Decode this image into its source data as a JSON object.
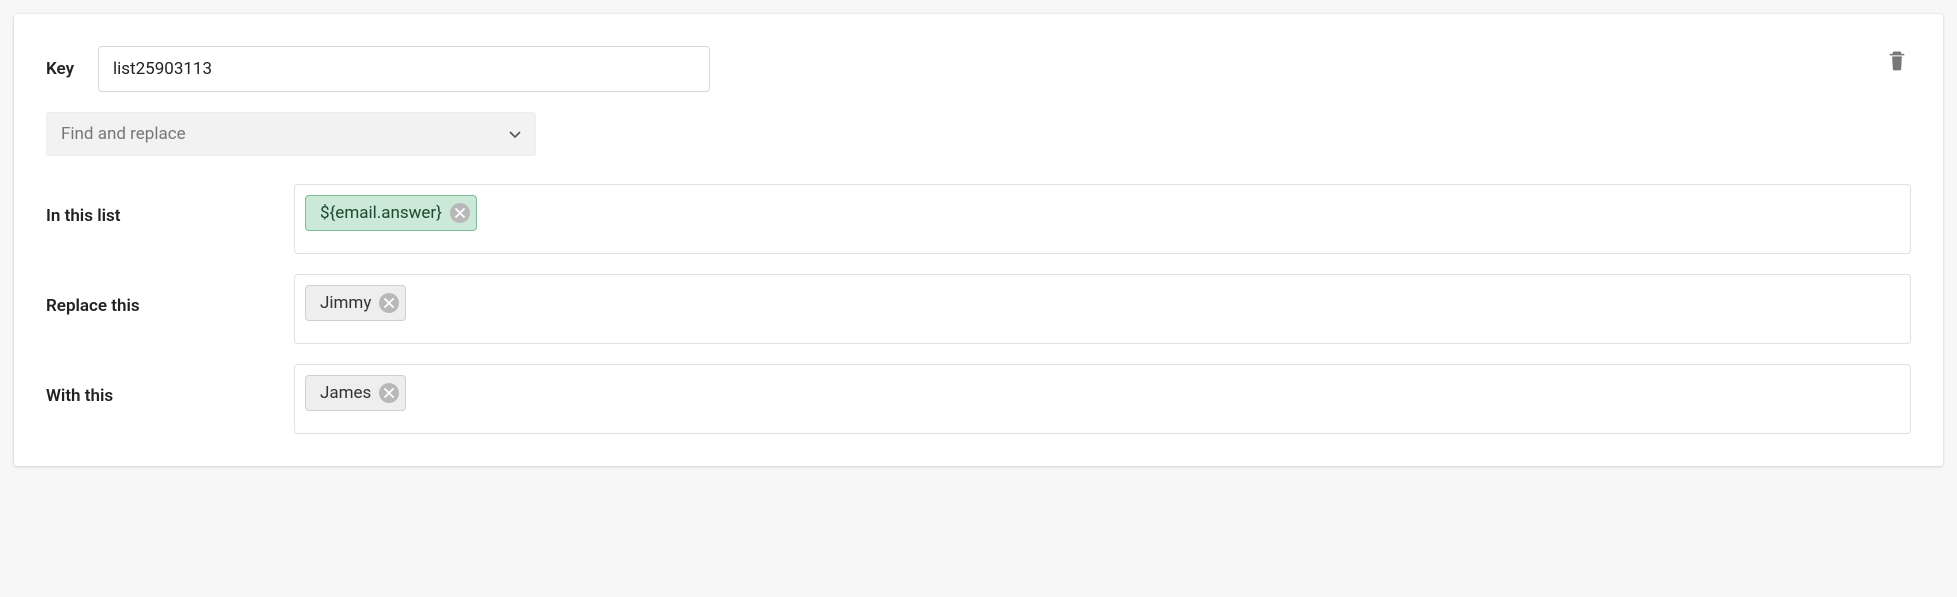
{
  "key": {
    "label": "Key",
    "value": "list25903113"
  },
  "action": {
    "selected": "Find and replace"
  },
  "fields": {
    "inList": {
      "label": "In this list",
      "chip": "${email.answer}",
      "chipStyle": "green"
    },
    "replace": {
      "label": "Replace this",
      "chip": "Jimmy",
      "chipStyle": "gray"
    },
    "with": {
      "label": "With this",
      "chip": "James",
      "chipStyle": "gray"
    }
  }
}
